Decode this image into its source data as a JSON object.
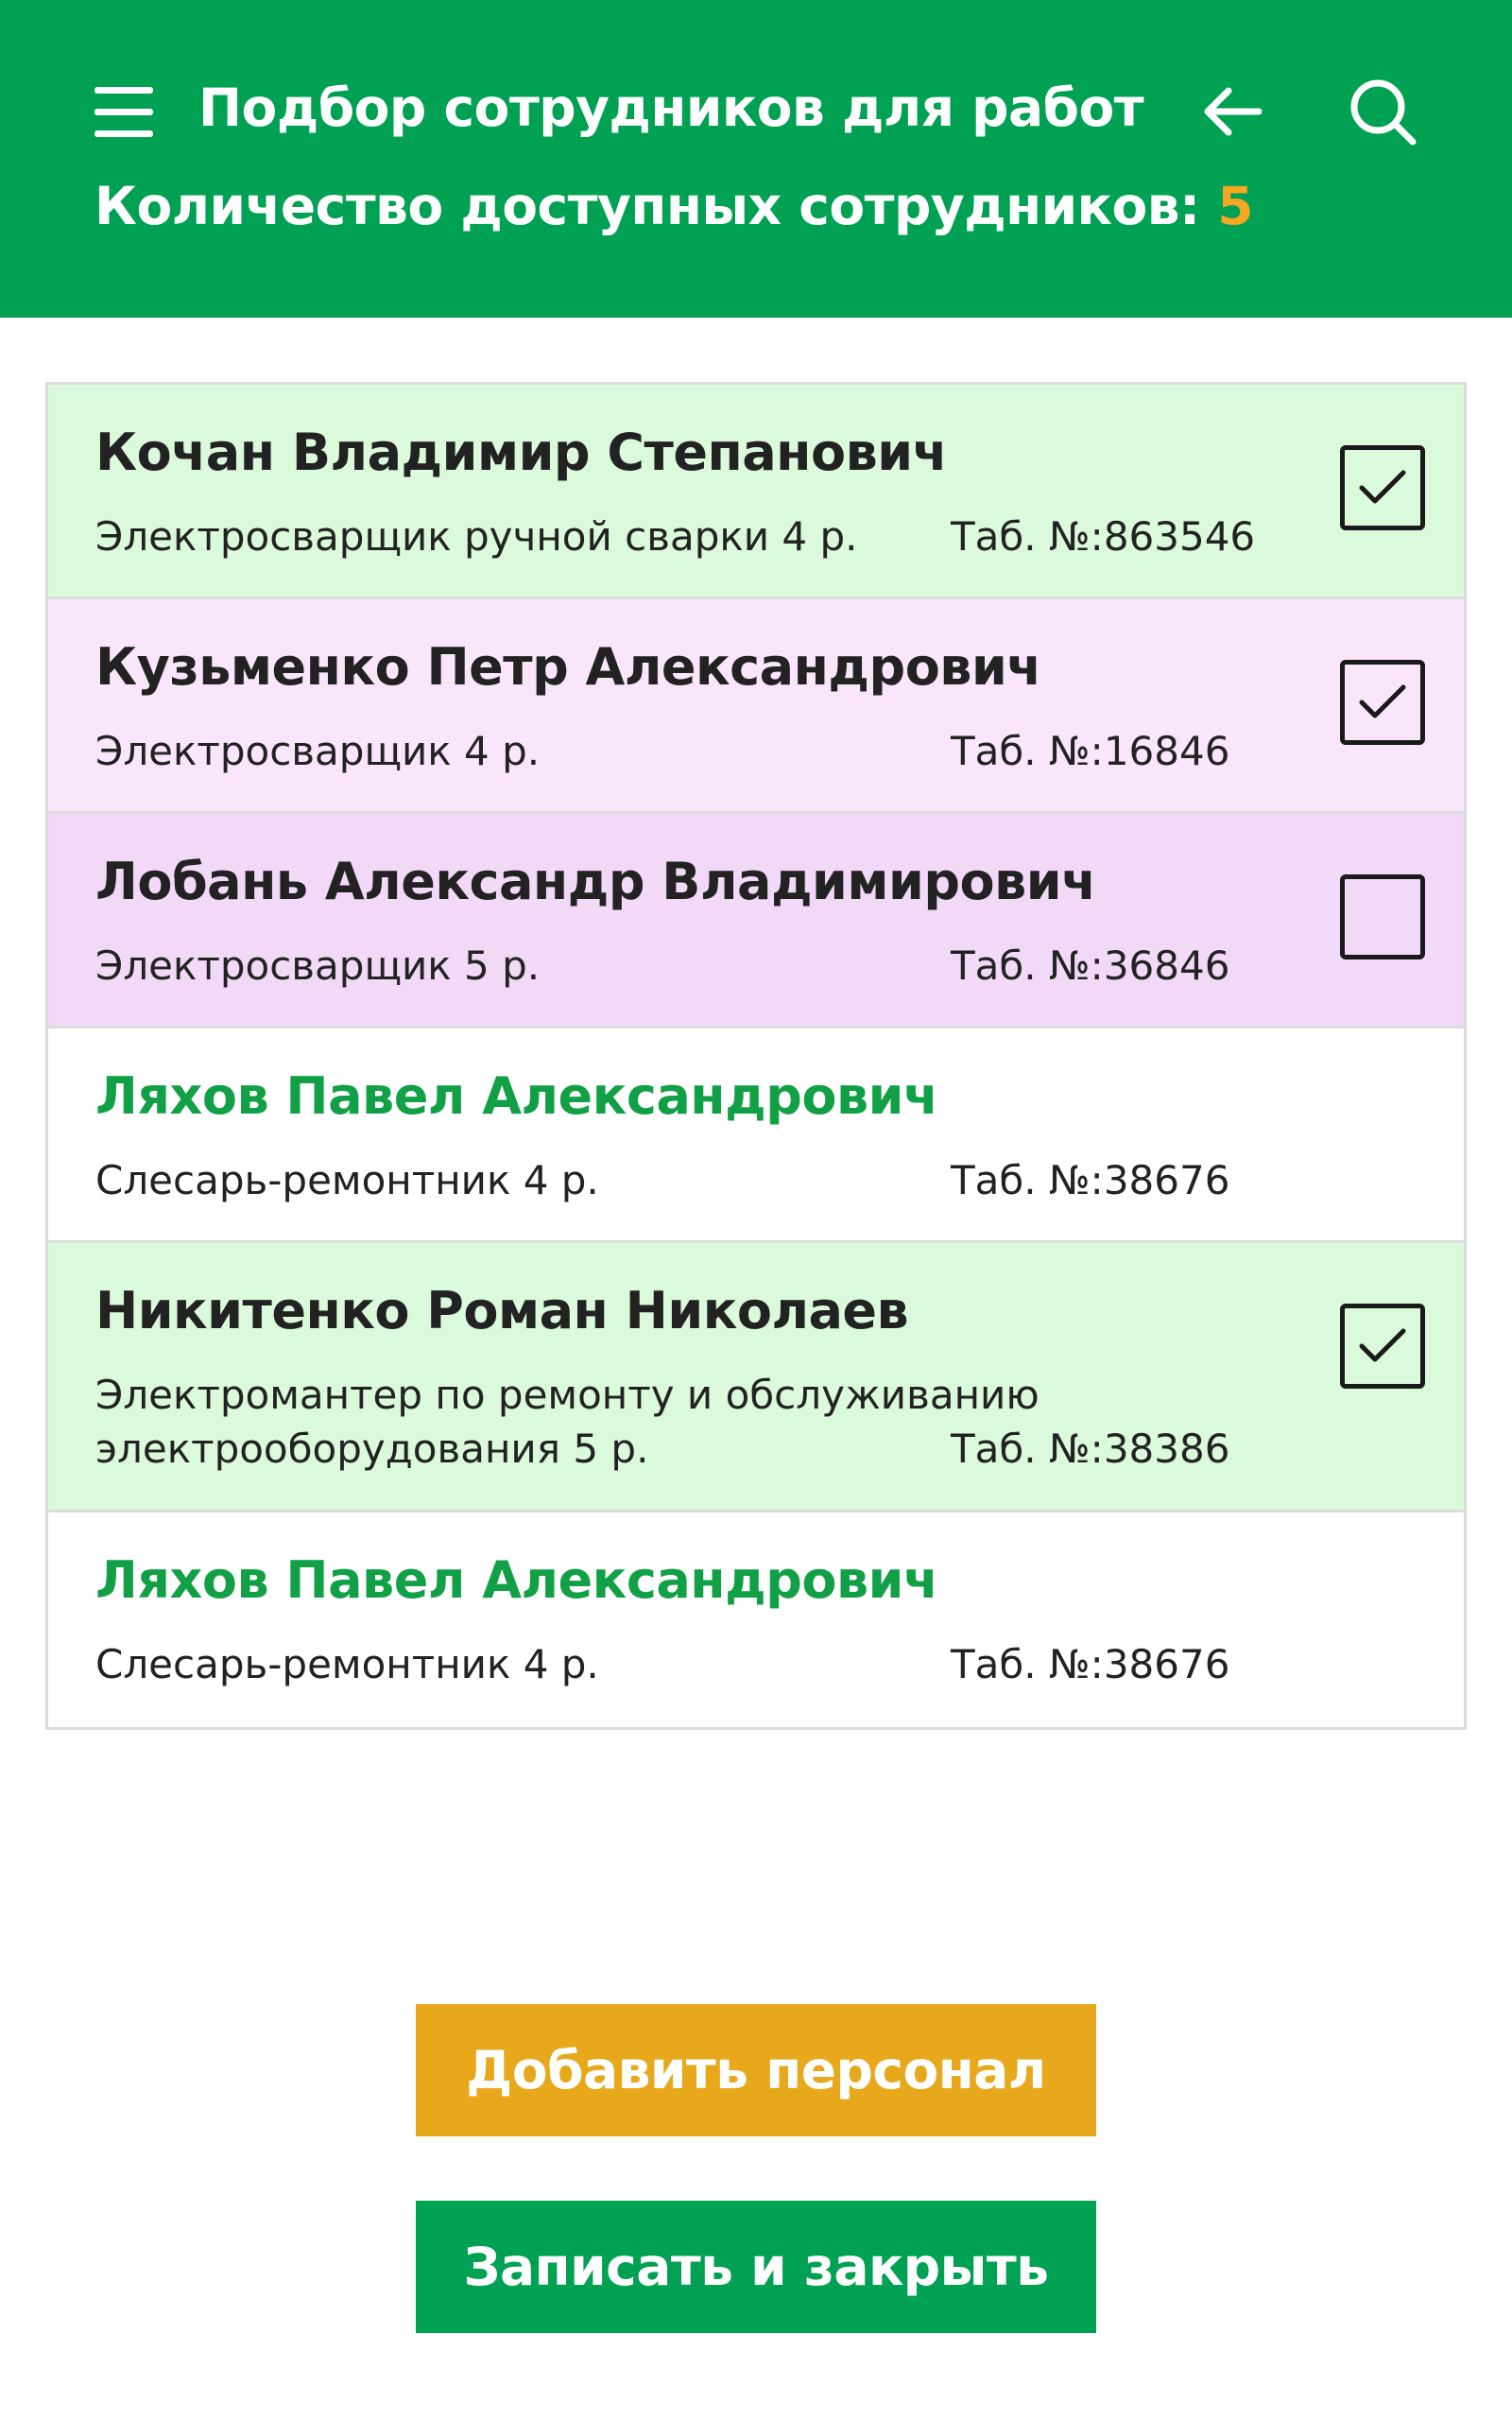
{
  "header": {
    "title": "Подбор сотрудников для работ",
    "count_label": "Количество доступных сотрудников:",
    "count_value": "5",
    "menu_icon": "hamburger-menu-icon",
    "back_icon": "arrow-left-icon",
    "search_icon": "search-icon"
  },
  "colors": {
    "primary": "#00A152",
    "accent": "#F7A823",
    "row_green": "#DBF9DB",
    "row_pink": "#F9E6FB",
    "row_violet": "#F1D9F7",
    "name_green": "#12A047"
  },
  "employees": [
    {
      "name": "Кочан Владимир Степанович",
      "position": "Электросварщик ручной сварки 4 р.",
      "tab": "Таб. №:863546",
      "checked": true
    },
    {
      "name": "Кузьменко Петр Александрович",
      "position": "Электросварщик 4 р.",
      "tab": "Таб. №:16846",
      "checked": true
    },
    {
      "name": "Лобань Александр Владимирович",
      "position": "Электросварщик 5 р.",
      "tab": "Таб. №:36846",
      "checked": false
    },
    {
      "name": "Ляхов Павел Александрович",
      "position": "Слесарь-ремонтник 4 р.",
      "tab": "Таб. №:38676"
    },
    {
      "name": "Никитенко Роман Николаев",
      "position": "Электромантер по ремонту и обслуживанию электрооборудования 5 р.",
      "tab": "Таб. №:38386",
      "checked": true
    },
    {
      "name": "Ляхов Павел Александрович",
      "position": "Слесарь-ремонтник 4 р.",
      "tab": "Таб. №:38676"
    }
  ],
  "buttons": {
    "add_label": "Добавить персонал",
    "save_label": "Записать и закрыть"
  }
}
